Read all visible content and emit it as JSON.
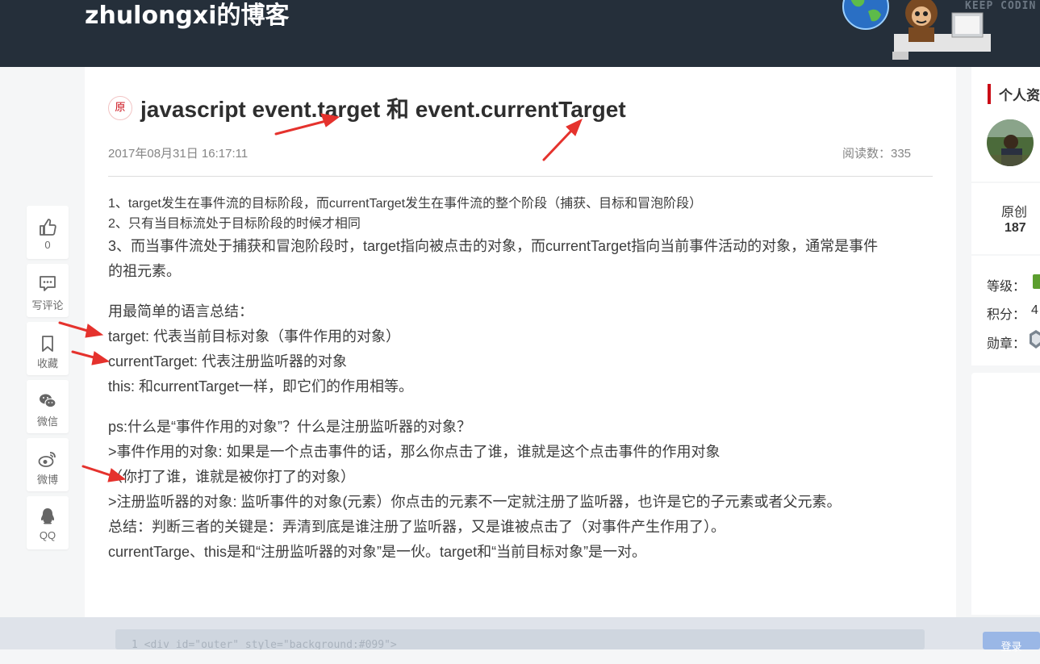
{
  "header": {
    "blog_title": "zhulongxi的博客",
    "banner_text": "KEEP CODIN"
  },
  "article": {
    "badge": "原",
    "title": "javascript event.target 和 event.currentTarget",
    "date": "2017年08月31日 16:17:11",
    "views": "阅读数：335",
    "paragraphs": [
      "1、target发生在事件流的目标阶段，而currentTarget发生在事件流的整个阶段（捕获、目标和冒泡阶段）",
      "2、只有当目标流处于目标阶段的时候才相同",
      "3、而当事件流处于捕获和冒泡阶段时，target指向被点击的对象，而currentTarget指向当前事件活动的对象，通常是事件",
      "的祖元素。",
      "用最简单的语言总结：",
      "target: 代表当前目标对象（事件作用的对象）",
      "currentTarget: 代表注册监听器的对象",
      "this: 和currentTarget一样，即它们的作用相等。",
      "ps:什么是“事件作用的对象”？什么是注册监听器的对象？",
      ">事件作用的对象: 如果是一个点击事件的话，那么你点击了谁，谁就是这个点击事件的作用对象",
      "（你打了谁，谁就是被你打了的对象）",
      ">注册监听器的对象: 监听事件的对象(元素）你点击的元素不一定就注册了监听器，也许是它的子元素或者父元素。",
      "总结：判断三者的关键是：弄清到底是谁注册了监听器，又是谁被点击了（对事件产生作用了）。",
      "currentTarge、this是和“注册监听器的对象”是一伙。target和“当前目标对象”是一对。"
    ]
  },
  "toolbar": {
    "like_count": "0",
    "comment_label": "写评论",
    "collect_label": "收藏",
    "wechat_label": "微信",
    "weibo_label": "微博",
    "qq_label": "QQ"
  },
  "sidebar": {
    "profile_title": "个人资",
    "original_label": "原创",
    "original_count": "187",
    "level_label": "等级：",
    "points_label": "积分：",
    "points_value": "4",
    "badge_label": "勋章："
  },
  "footer": {
    "code_snippet": "1  <div id=\"outer\" style=\"background:#099\">",
    "login_label": "登录"
  },
  "colors": {
    "header_bg": "#252f3a",
    "accent_red": "#ca0c16",
    "annotation_red": "#e5322d",
    "level_green": "#5c9e2e"
  }
}
